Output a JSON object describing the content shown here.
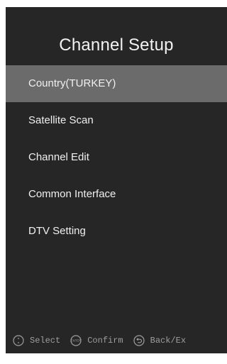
{
  "screen": {
    "title": "Channel Setup"
  },
  "menu": {
    "items": [
      {
        "label": "Country(TURKEY)",
        "selected": true
      },
      {
        "label": "Satellite Scan",
        "selected": false
      },
      {
        "label": "Channel Edit",
        "selected": false
      },
      {
        "label": "Common Interface",
        "selected": false
      },
      {
        "label": "DTV Setting",
        "selected": false
      }
    ]
  },
  "footer": {
    "select_label": "Select",
    "confirm_label": "Confirm",
    "back_label": "Back/Ex",
    "enter_icon_text": "ENTER"
  },
  "colors": {
    "panel_bg": "#262626",
    "selected_bg": "#6b6b6b",
    "text": "#f0f0f0",
    "hint_text": "#9e9e9e"
  },
  "icons": {
    "select": "select-icon",
    "confirm": "enter-icon",
    "back": "back-icon"
  }
}
